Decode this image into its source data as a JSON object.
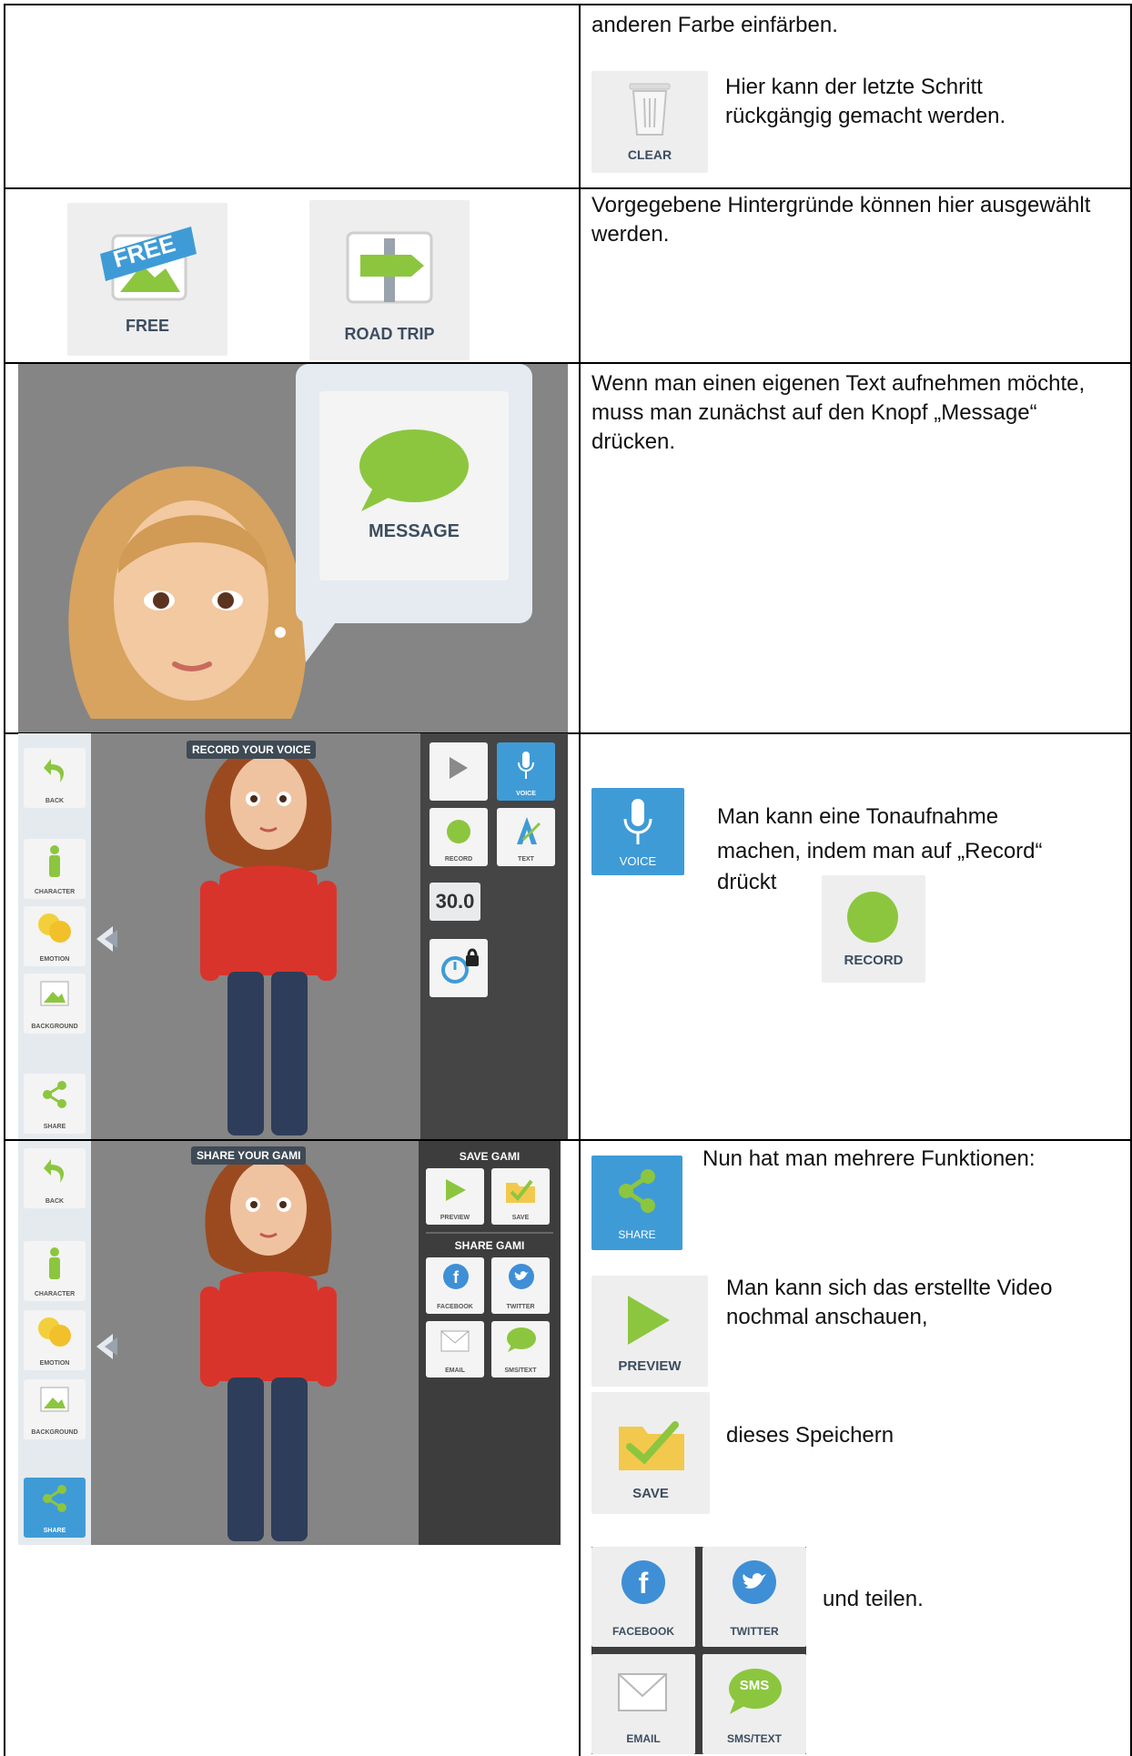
{
  "rows": {
    "clear": {
      "intro_text": "anderen Farbe einfärben.",
      "description": "Hier kann der letzte Schritt rückgängig gemacht werden.",
      "icon": "trash-icon",
      "button_label": "CLEAR"
    },
    "backgrounds": {
      "description": "Vorgegebene Hintergründe können hier ausgewählt werden.",
      "free_label": "FREE",
      "free_banner": "FREE",
      "road_trip_label": "ROAD TRIP"
    },
    "message": {
      "description": "Wenn man einen eigenen Text aufnehmen möchte, muss man zunächst auf den Knopf „Message“ drücken.",
      "button_label": "MESSAGE"
    },
    "record": {
      "banner": "RECORD YOUR VOICE",
      "sidebar": [
        "BACK",
        "CHARACTER",
        "EMOTION",
        "BACKGROUND",
        "SHARE"
      ],
      "panel": [
        "",
        "VOICE",
        "RECORD",
        "TEXT"
      ],
      "timer": "30.0",
      "description_line1": "Man kann eine Tonaufnahme",
      "description_line2": "machen, indem man auf „Record“",
      "description_line3": "drückt",
      "voice_label": "VOICE",
      "record_label": "RECORD"
    },
    "share": {
      "banner": "SHARE YOUR GAMI",
      "sidebar": [
        "BACK",
        "CHARACTER",
        "EMOTION",
        "BACKGROUND",
        "SHARE"
      ],
      "save_heading": "SAVE GAMI",
      "share_heading": "SHARE GAMI",
      "panel": [
        "PREVIEW",
        "SAVE",
        "FACEBOOK",
        "TWITTER",
        "EMAIL",
        "SMS/TEXT"
      ],
      "intro": "Nun hat man mehrere Funktionen:",
      "share_label": "SHARE",
      "preview_text": "Man kann sich das erstellte Video nochmal anschauen,",
      "preview_label": "PREVIEW",
      "save_text": "dieses Speichern",
      "save_label": "SAVE",
      "share_text": "und teilen.",
      "facebook_label": "FACEBOOK",
      "twitter_label": "TWITTER",
      "email_label": "EMAIL",
      "sms_label": "SMS/TEXT",
      "sms_badge": "SMS"
    }
  },
  "colors": {
    "green": "#8cc63f",
    "blue": "#3f9bd6",
    "dark_panel": "#454545",
    "gray_bg": "#878787"
  }
}
